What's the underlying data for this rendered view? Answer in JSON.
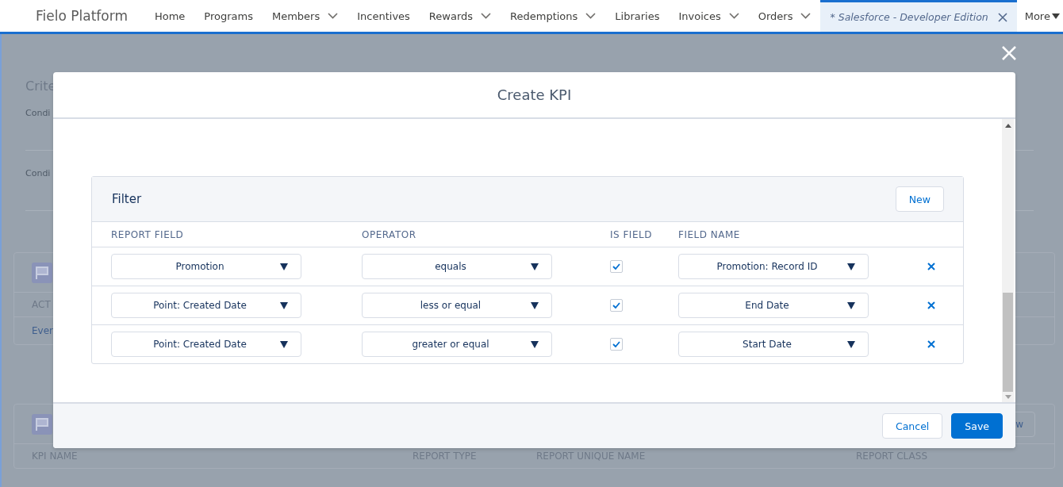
{
  "app_name": "Fielo Platform",
  "nav_items": [
    {
      "label": "Home",
      "has_menu": false,
      "selected": false,
      "kind": "link"
    },
    {
      "label": "Programs",
      "has_menu": false,
      "selected": false,
      "kind": "link"
    },
    {
      "label": "Members",
      "has_menu": true,
      "selected": false,
      "kind": "link"
    },
    {
      "label": "Incentives",
      "has_menu": false,
      "selected": false,
      "kind": "link"
    },
    {
      "label": "Rewards",
      "has_menu": true,
      "selected": false,
      "kind": "link"
    },
    {
      "label": "Redemptions",
      "has_menu": true,
      "selected": false,
      "kind": "link"
    },
    {
      "label": "Libraries",
      "has_menu": false,
      "selected": false,
      "kind": "link"
    },
    {
      "label": "Invoices",
      "has_menu": true,
      "selected": false,
      "kind": "link"
    },
    {
      "label": "Orders",
      "has_menu": true,
      "selected": false,
      "kind": "link"
    },
    {
      "label": "* Salesforce - Developer Edition",
      "selected": true,
      "kind": "tab"
    },
    {
      "label": "More",
      "selected": false,
      "kind": "more"
    }
  ],
  "background": {
    "criteria_title": "Crite",
    "condition_labels": [
      "Condi",
      "Condi"
    ],
    "table_1": {
      "header": "ACT",
      "row": "Even"
    },
    "table_2": {
      "button": "w",
      "columns": [
        "KPI NAME",
        "REPORT TYPE",
        "REPORT UNIQUE NAME",
        "REPORT CLASS"
      ]
    }
  },
  "modal": {
    "title": "Create KPI",
    "filter": {
      "title": "Filter",
      "new_button": "New",
      "columns": [
        "REPORT FIELD",
        "OPERATOR",
        "IS FIELD",
        "FIELD NAME"
      ],
      "rows": [
        {
          "report_field": "Promotion",
          "operator": "equals",
          "is_field": true,
          "field_name": "Promotion: Record ID"
        },
        {
          "report_field": "Point: Created Date",
          "operator": "less or equal",
          "is_field": true,
          "field_name": "End Date"
        },
        {
          "report_field": "Point: Created Date",
          "operator": "greater or equal",
          "is_field": true,
          "field_name": "Start Date"
        }
      ]
    },
    "buttons": [
      {
        "label": "Cancel",
        "kind": "neutral"
      },
      {
        "label": "Save",
        "kind": "brand"
      }
    ]
  }
}
